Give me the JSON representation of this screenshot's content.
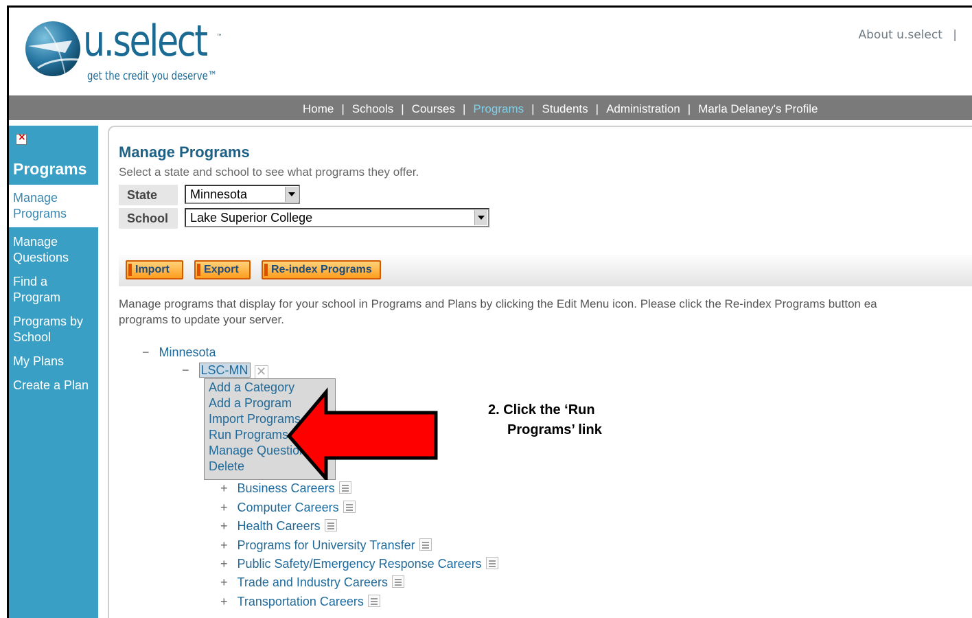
{
  "header": {
    "logo_name": "u.select",
    "logo_tm": "™",
    "logo_tagline": "get the credit you deserve™",
    "top_link_about": "About u.select",
    "top_link_sep": "|"
  },
  "nav": {
    "items": [
      "Home",
      "Schools",
      "Courses",
      "Programs",
      "Students",
      "Administration",
      "Marla Delaney's Profile"
    ],
    "active": "Programs",
    "sep": "|"
  },
  "sidebar": {
    "title": "Programs",
    "items": [
      "Manage Programs",
      "Manage Questions",
      "Find a Program",
      "Programs by School",
      "My Plans",
      "Create a Plan"
    ],
    "active": "Manage Programs",
    "accent": "#3a9fc4"
  },
  "main": {
    "title": "Manage Programs",
    "subtitle": "Select a state and school to see what programs they offer.",
    "state_label": "State",
    "state_value": "Minnesota",
    "school_label": "School",
    "school_value": "Lake Superior College",
    "buttons": {
      "import": "Import",
      "export": "Export",
      "reindex": "Re-index Programs"
    },
    "description_line1": "Manage programs that display for your school in Programs and Plans by clicking the Edit Menu icon.   Please click the Re-index Programs button ea",
    "description_line2": "programs to update your server.",
    "tree_root": "Minnesota",
    "tree_toggle_minus": "−",
    "tree_toggle_plus": "+",
    "tree_node": "LSC-MN",
    "context_menu": [
      "Add a Category",
      "Add a Program",
      "Import Programs",
      "Run Programs",
      "Manage Questions",
      "Delete"
    ],
    "categories": [
      "Business Careers",
      "Computer Careers",
      "Health Careers",
      "Programs for University Transfer",
      "Public Safety/Emergency Response Careers",
      "Trade and Industry Careers",
      "Transportation Careers"
    ]
  },
  "annotation": {
    "line1": "2. Click the ‘Run",
    "line2": "Programs’ link",
    "arrow_color": "#ff0000"
  }
}
